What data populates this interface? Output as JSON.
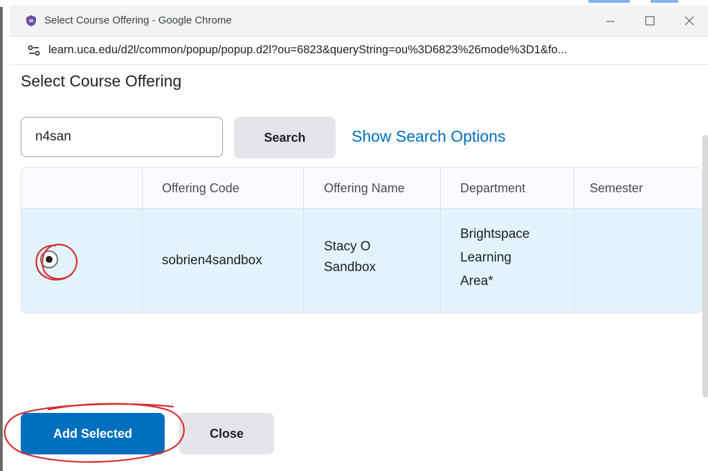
{
  "window": {
    "title": "Select Course Offering - Google Chrome",
    "url": "learn.uca.edu/d2l/common/popup/popup.d2l?ou=6823&queryString=ou%3D6823%26mode%3D1&fo...",
    "favicon": "shield-icon",
    "site_info_icon": "tune-icon"
  },
  "dialog": {
    "title": "Select Course Offering",
    "search": {
      "value": "n4san",
      "button_label": "Search"
    },
    "show_search_options": "Show Search Options",
    "table": {
      "headers": [
        "",
        "Offering Code",
        "Offering Name",
        "Department",
        "Semester"
      ],
      "rows": [
        {
          "selected": true,
          "offering_code": "sobrien4sandbox",
          "offering_name": [
            "Stacy O",
            "Sandbox"
          ],
          "department": [
            "Brightspace",
            "Learning",
            "Area*"
          ],
          "semester": ""
        }
      ]
    },
    "buttons": {
      "add_selected": "Add Selected",
      "close": "Close"
    }
  },
  "colors": {
    "primary": "#006fbf",
    "selected_row": "#e3f3fc",
    "annotation": "#d32f2f"
  }
}
